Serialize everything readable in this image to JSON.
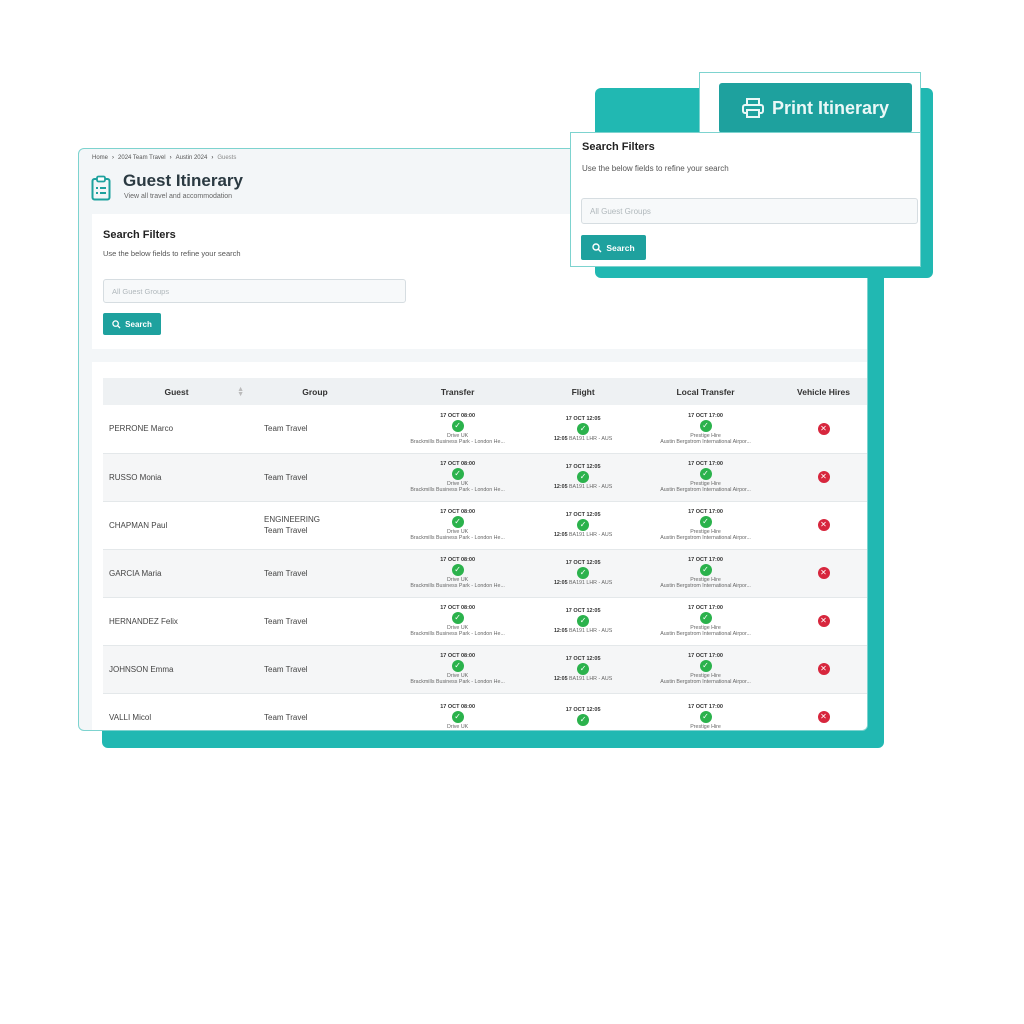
{
  "breadcrumb": [
    "Home",
    "2024 Team Travel",
    "Austin 2024",
    "Guests"
  ],
  "page": {
    "title": "Guest Itinerary",
    "subtitle": "View all travel and accommodation"
  },
  "filters": {
    "title": "Search Filters",
    "description": "Use the below fields to refine your search",
    "placeholder": "All Guest Groups",
    "search_label": "Search"
  },
  "print_label": "Print Itinerary",
  "table": {
    "headers": {
      "guest": "Guest",
      "group": "Group",
      "transfer": "Transfer",
      "flight": "Flight",
      "local_transfer": "Local Transfer",
      "vehicle_hires": "Vehicle Hires"
    },
    "rows": [
      {
        "guest": "PERRONE Marco",
        "group": "Team Travel",
        "group2": "",
        "transfer_time": "17 OCT 08:00",
        "transfer_provider": "Drive UK",
        "transfer_route": "Brackmills Business Park - London He...",
        "flight_date": "17 OCT 12:05",
        "flight_time": "12:05",
        "flight_route": "BA191 LHR - AUS",
        "local_time": "17 OCT 17:00",
        "local_provider": "Prestige Hire",
        "local_route": "Austin Bergstrom International Airpor..."
      },
      {
        "guest": "RUSSO Monia",
        "group": "Team Travel",
        "group2": "",
        "transfer_time": "17 OCT 08:00",
        "transfer_provider": "Drive UK",
        "transfer_route": "Brackmills Business Park - London He...",
        "flight_date": "17 OCT 12:05",
        "flight_time": "12:05",
        "flight_route": "BA191 LHR - AUS",
        "local_time": "17 OCT 17:00",
        "local_provider": "Prestige Hire",
        "local_route": "Austin Bergstrom International Airpor..."
      },
      {
        "guest": "CHAPMAN Paul",
        "group": "ENGINEERING",
        "group2": "Team Travel",
        "transfer_time": "17 OCT 08:00",
        "transfer_provider": "Drive UK",
        "transfer_route": "Brackmills Business Park - London He...",
        "flight_date": "17 OCT 12:05",
        "flight_time": "12:05",
        "flight_route": "BA191 LHR - AUS",
        "local_time": "17 OCT 17:00",
        "local_provider": "Prestige Hire",
        "local_route": "Austin Bergstrom International Airpor..."
      },
      {
        "guest": "GARCIA Maria",
        "group": "Team Travel",
        "group2": "",
        "transfer_time": "17 OCT 08:00",
        "transfer_provider": "Drive UK",
        "transfer_route": "Brackmills Business Park - London He...",
        "flight_date": "17 OCT 12:05",
        "flight_time": "12:05",
        "flight_route": "BA191 LHR - AUS",
        "local_time": "17 OCT 17:00",
        "local_provider": "Prestige Hire",
        "local_route": "Austin Bergstrom International Airpor..."
      },
      {
        "guest": "HERNANDEZ Felix",
        "group": "Team Travel",
        "group2": "",
        "transfer_time": "17 OCT 08:00",
        "transfer_provider": "Drive UK",
        "transfer_route": "Brackmills Business Park - London He...",
        "flight_date": "17 OCT 12:05",
        "flight_time": "12:05",
        "flight_route": "BA191 LHR - AUS",
        "local_time": "17 OCT 17:00",
        "local_provider": "Prestige Hire",
        "local_route": "Austin Bergstrom International Airpor..."
      },
      {
        "guest": "JOHNSON Emma",
        "group": "Team Travel",
        "group2": "",
        "transfer_time": "17 OCT 08:00",
        "transfer_provider": "Drive UK",
        "transfer_route": "Brackmills Business Park - London He...",
        "flight_date": "17 OCT 12:05",
        "flight_time": "12:05",
        "flight_route": "BA191 LHR - AUS",
        "local_time": "17 OCT 17:00",
        "local_provider": "Prestige Hire",
        "local_route": "Austin Bergstrom International Airpor..."
      },
      {
        "guest": "VALLI Micol",
        "group": "Team Travel",
        "group2": "",
        "transfer_time": "17 OCT 08:00",
        "transfer_provider": "Drive UK",
        "transfer_route": "",
        "flight_date": "17 OCT 12:05",
        "flight_time": "",
        "flight_route": "",
        "local_time": "17 OCT 17:00",
        "local_provider": "Prestige Hire",
        "local_route": ""
      }
    ]
  },
  "icons": {
    "clipboard": "clipboard-icon",
    "printer": "printer-icon",
    "search": "search-icon",
    "check": "check-circle-icon",
    "cross": "x-circle-icon",
    "sort": "sort-icon"
  },
  "colors": {
    "accent": "#1ea19e",
    "accent_shadow": "#21b8b2",
    "success": "#2bb24c",
    "danger": "#d7263d"
  }
}
